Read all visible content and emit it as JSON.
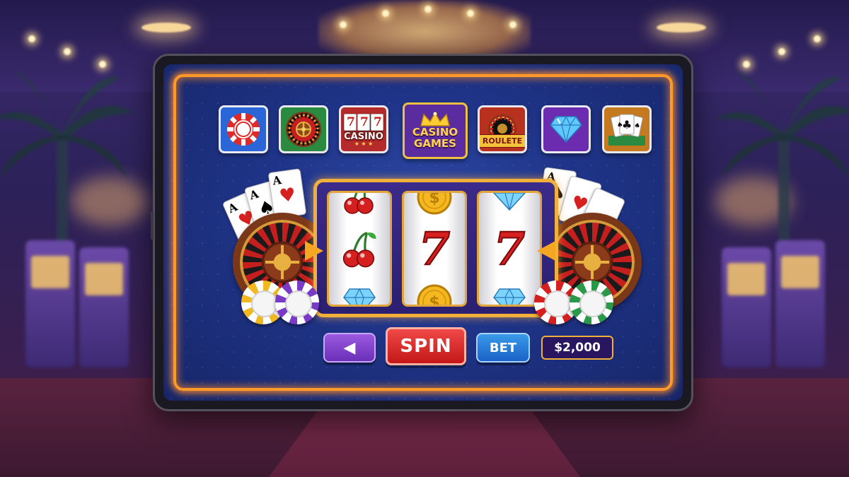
{
  "top_menu": {
    "icons": [
      {
        "name": "poker-chip-icon"
      },
      {
        "name": "roulette-wheel-icon"
      },
      {
        "name": "lucky-777-icon",
        "label": "CASINO",
        "digits": "777"
      },
      {
        "name": "casino-games-icon",
        "label": "CASINO GAMES"
      },
      {
        "name": "roulete-icon",
        "label": "ROULETE"
      },
      {
        "name": "diamond-icon"
      },
      {
        "name": "playing-cards-icon"
      }
    ]
  },
  "reels": [
    {
      "top": "cherry",
      "middle": "cherry",
      "bottom": "diamond"
    },
    {
      "top": "coin",
      "middle": "7",
      "bottom": "coin"
    },
    {
      "top": "diamond",
      "middle": "7",
      "bottom": "diamond"
    }
  ],
  "controls": {
    "back_symbol": "◀",
    "spin_label": "SPIN",
    "bet_label": "BET",
    "balance": "$2,000"
  },
  "cards_left": [
    "A",
    "A",
    "A"
  ],
  "cards_right": [
    "A"
  ],
  "colors": {
    "neon_border": "#ff9a2a",
    "spin_button": "#d62020",
    "bet_button": "#1a62c8",
    "back_button": "#7a3ac8",
    "screen_bg": "#1f3488"
  }
}
